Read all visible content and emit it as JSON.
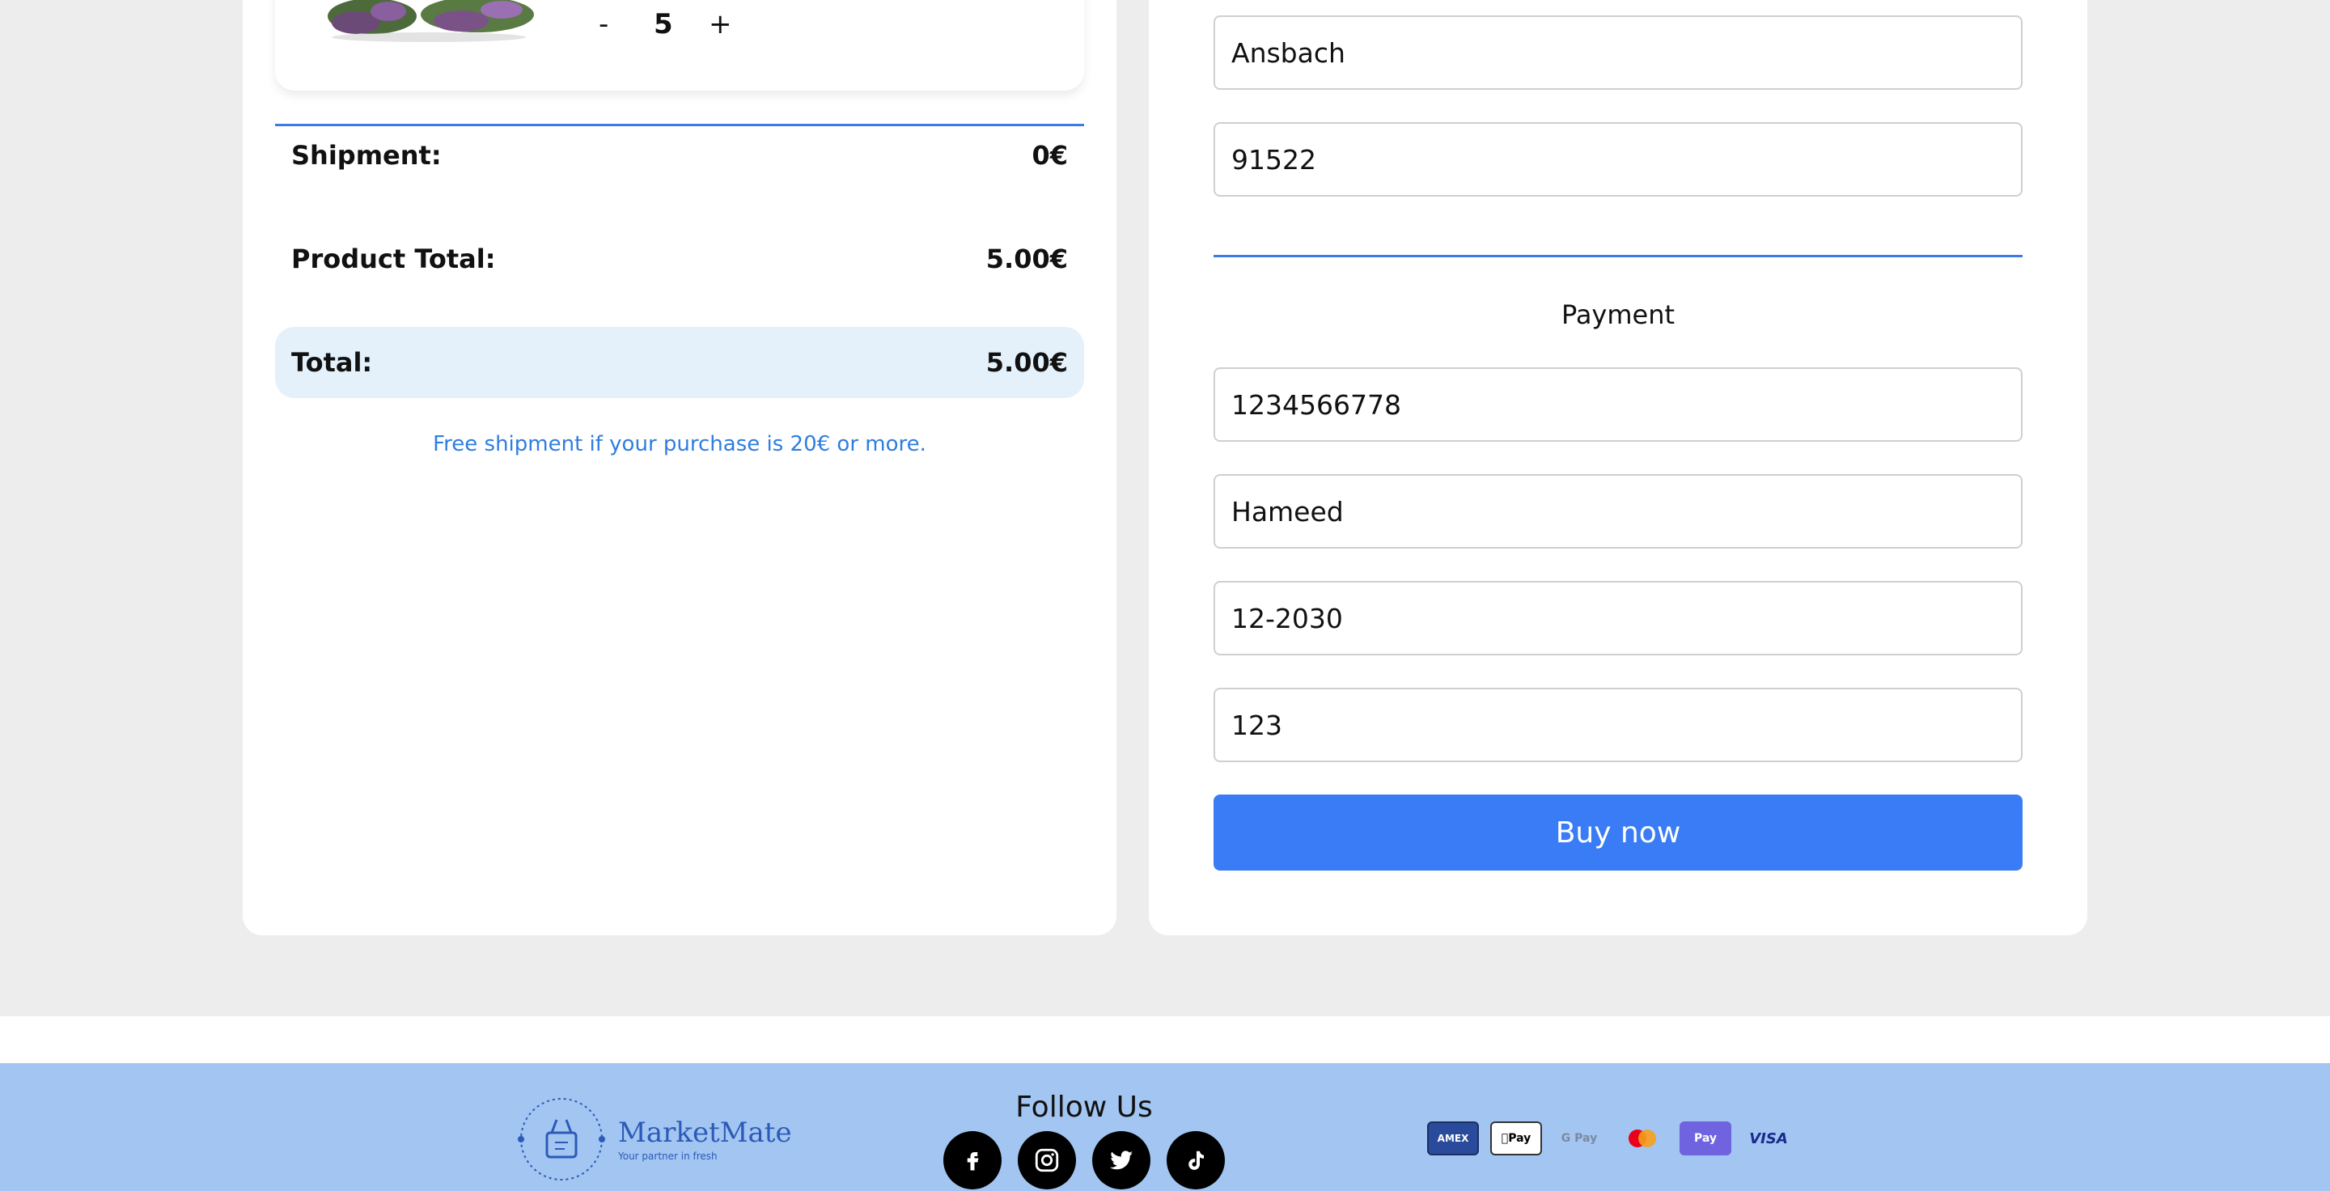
{
  "cart": {
    "quantity_minus": "-",
    "quantity_value": "5",
    "quantity_plus": "+",
    "shipment_label": "Shipment:",
    "shipment_value": "0€",
    "product_total_label": "Product Total:",
    "product_total_value": "5.00€",
    "total_label": "Total:",
    "total_value": "5.00€",
    "free_shipment_note": "Free shipment if your purchase is 20€ or more."
  },
  "address": {
    "city": "Ansbach",
    "postal_code": "91522"
  },
  "payment": {
    "title": "Payment",
    "card_number": "1234566778",
    "card_holder": "Hameed",
    "expiry": "12-2030",
    "cvc": "123",
    "buy_label": "Buy now"
  },
  "footer": {
    "brand_name": "MarketMate",
    "brand_tagline": "Your partner in fresh",
    "follow_title": "Follow Us",
    "social_icons": [
      "facebook-icon",
      "instagram-icon",
      "twitter-icon",
      "tiktok-icon"
    ],
    "payment_methods": {
      "amex": "AMEX",
      "apple": "Pay",
      "gpay": "G Pay",
      "shop": "Pay",
      "visa": "VISA"
    }
  },
  "colors": {
    "accent": "#3a7cf5",
    "divider": "#3a7be8",
    "total_bg": "#e4f1fb",
    "footer_bg": "#a2c5f1",
    "page_bg": "#ededed"
  }
}
